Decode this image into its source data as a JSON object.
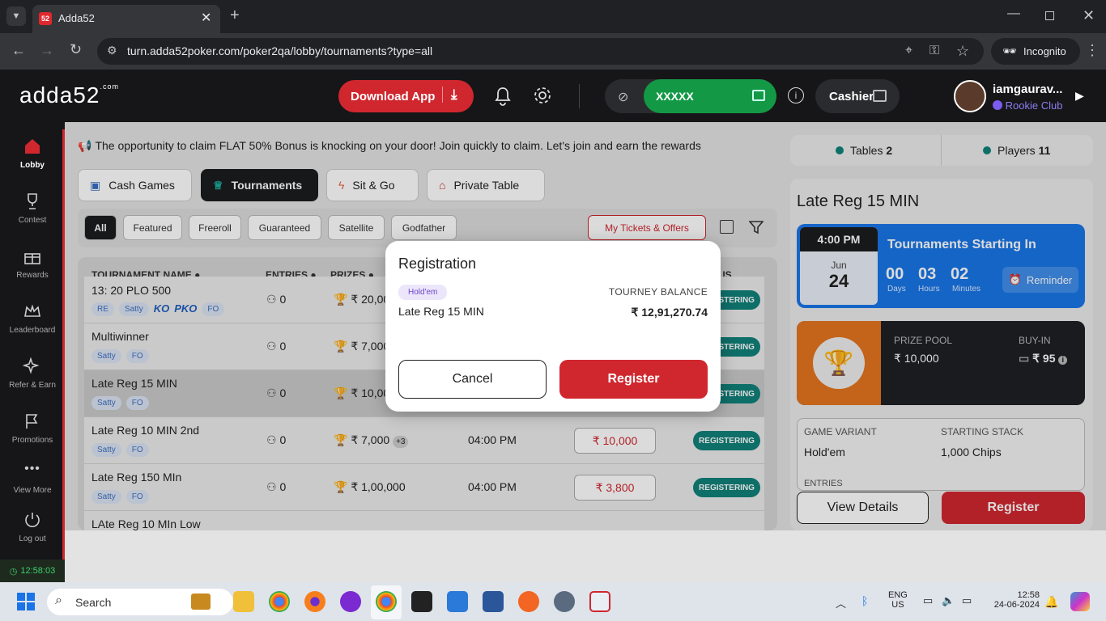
{
  "browser": {
    "tab_title": "Adda52",
    "tab_favicon": "52",
    "url": "turn.adda52poker.com/poker2qa/lobby/tournaments?type=all",
    "incognito_label": "Incognito"
  },
  "header": {
    "logo": "adda52",
    "logo_suffix": ".com",
    "download_label": "Download App",
    "balance_masked": "XXXXX",
    "cashier_label": "Cashier",
    "username": "iamgaurav...",
    "club": "Rookie Club"
  },
  "sidebar": {
    "items": [
      {
        "label": "Lobby",
        "icon": "home-icon"
      },
      {
        "label": "Contest",
        "icon": "trophy-icon"
      },
      {
        "label": "Rewards",
        "icon": "gift-icon"
      },
      {
        "label": "Leaderboard",
        "icon": "crown-icon"
      },
      {
        "label": "Refer & Earn",
        "icon": "sparkle-icon"
      },
      {
        "label": "Promotions",
        "icon": "flag-icon"
      },
      {
        "label": "View More",
        "icon": "more-icon"
      },
      {
        "label": "Log out",
        "icon": "power-icon"
      }
    ],
    "clock": "12:58:03"
  },
  "promo": "The opportunity to claim FLAT 50% Bonus is knocking on your door! Join quickly to claim. Let's join and earn the rewards",
  "game_tabs": [
    "Cash Games",
    "Tournaments",
    "Sit & Go",
    "Private Table"
  ],
  "filters": [
    "All",
    "Featured",
    "Freeroll",
    "Guaranteed",
    "Satellite",
    "Godfather"
  ],
  "tickets_label": "My Tickets & Offers",
  "table": {
    "headers": {
      "name": "TOURNAMENT NAME",
      "entries": "ENTRIES",
      "prizes": "PRIZES",
      "status": "US"
    },
    "rows": [
      {
        "name": "13: 20 PLO 500",
        "tags": [
          "RE",
          "Satty",
          "KO",
          "PKO",
          "FO"
        ],
        "entries": "0",
        "prize": "₹ 20,000",
        "time": "",
        "buyin": "",
        "status": "REGISTERING"
      },
      {
        "name": "Multiwinner",
        "tags": [
          "Satty",
          "FO"
        ],
        "entries": "0",
        "prize": "₹ 7,000",
        "time": "",
        "buyin": "",
        "status": "REGISTERING"
      },
      {
        "name": "Late Reg 15 MIN",
        "tags": [
          "Satty",
          "FO"
        ],
        "entries": "0",
        "prize": "₹ 10,000",
        "time": "",
        "buyin": "",
        "status": "REGISTERING"
      },
      {
        "name": "Late Reg 10 MIN 2nd",
        "tags": [
          "Satty",
          "FO"
        ],
        "entries": "0",
        "prize": "₹ 7,000",
        "extra": "+3",
        "time": "04:00 PM",
        "buyin": "₹ 10,000",
        "status": "REGISTERING"
      },
      {
        "name": "Late Reg 150 MIn",
        "tags": [
          "Satty",
          "FO"
        ],
        "entries": "0",
        "prize": "₹ 1,00,000",
        "time": "04:00 PM",
        "buyin": "₹ 3,800",
        "status": "REGISTERING"
      },
      {
        "name": "LAte Reg 10 MIn Low",
        "tags": [],
        "entries": "",
        "prize": "",
        "time": "",
        "buyin": "",
        "status": ""
      }
    ]
  },
  "right_panel": {
    "tables_label": "Tables",
    "tables_count": "2",
    "players_label": "Players",
    "players_count": "11",
    "title": "Late Reg 15 MIN",
    "start_time": "4:00 PM",
    "start_month": "Jun",
    "start_day": "24",
    "starting_in_label": "Tournaments Starting In",
    "days": "00",
    "days_label": "Days",
    "hours": "03",
    "hours_label": "Hours",
    "minutes": "02",
    "minutes_label": "Minutes",
    "reminder_label": "Reminder",
    "prize_pool_label": "PRIZE POOL",
    "prize_pool": "₹ 10,000",
    "buyin_label": "BUY-IN",
    "buyin": "₹ 95",
    "game_variant_label": "GAME VARIANT",
    "game_variant": "Hold'em",
    "starting_stack_label": "STARTING STACK",
    "starting_stack": "1,000 Chips",
    "entries_label": "ENTRIES",
    "view_details_label": "View Details",
    "register_label": "Register"
  },
  "modal": {
    "title": "Registration",
    "tag": "Hold'em",
    "tournament": "Late Reg 15 MIN",
    "balance_label": "TOURNEY BALANCE",
    "balance": "₹ 12,91,270.74",
    "cancel_label": "Cancel",
    "register_label": "Register"
  },
  "taskbar": {
    "search_placeholder": "Search",
    "lang1": "ENG",
    "lang2": "US",
    "time": "12:58",
    "date": "24-06-2024"
  },
  "colors": {
    "accent": "#d0272f",
    "green": "#139946",
    "teal": "#11807a",
    "blue": "#1976e8"
  }
}
